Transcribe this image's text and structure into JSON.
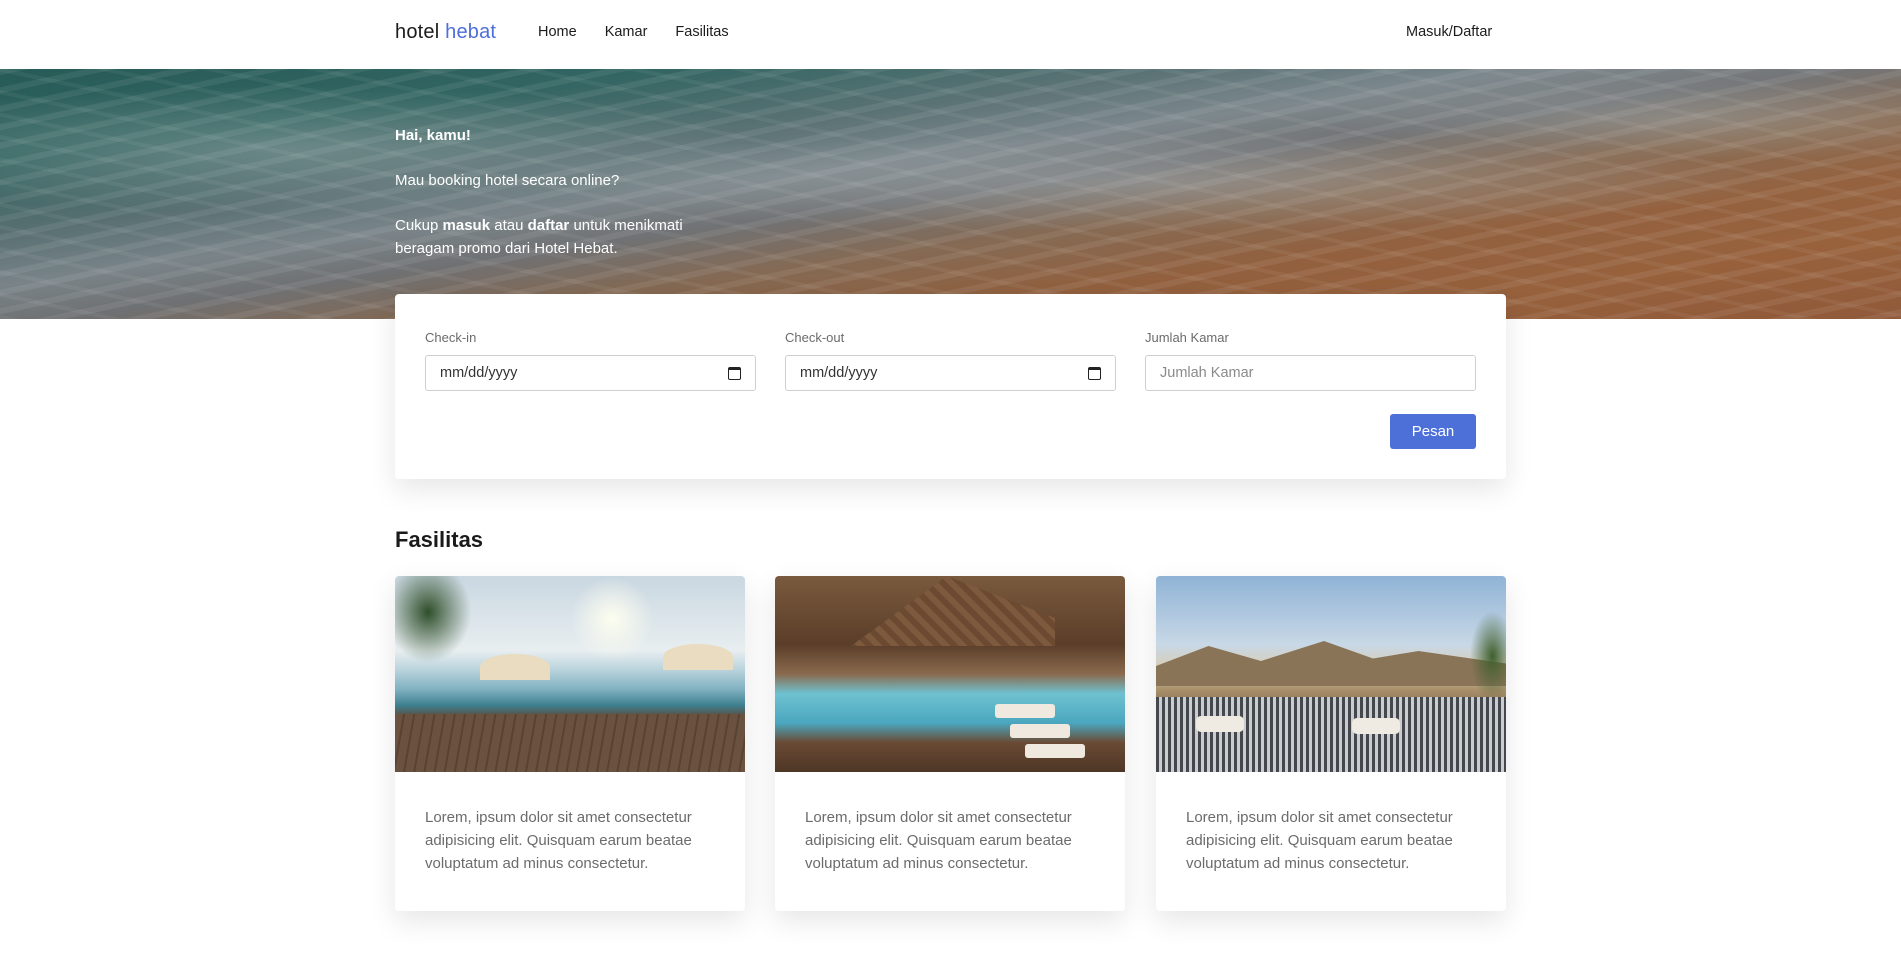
{
  "navbar": {
    "brand_part1": "hotel",
    "brand_part2": "hebat",
    "links": [
      "Home",
      "Kamar",
      "Fasilitas"
    ],
    "login": "Masuk/Daftar"
  },
  "hero": {
    "greeting": "Hai, kamu!",
    "question": "Mau booking hotel secara online?",
    "cta_prefix": "Cukup ",
    "cta_masuk": "masuk",
    "cta_atau": " atau ",
    "cta_daftar": "daftar",
    "cta_suffix": " untuk menikmati beragam promo dari Hotel Hebat."
  },
  "booking": {
    "checkin_label": "Check-in",
    "checkin_value": "mm/dd/yyyy",
    "checkout_label": "Check-out",
    "checkout_value": "mm/dd/yyyy",
    "rooms_label": "Jumlah Kamar",
    "rooms_placeholder": "Jumlah Kamar",
    "submit_label": "Pesan"
  },
  "facilities": {
    "title": "Fasilitas",
    "cards": [
      {
        "text": "Lorem, ipsum dolor sit amet consectetur adipisicing elit. Quisquam earum beatae voluptatum ad minus consectetur."
      },
      {
        "text": "Lorem, ipsum dolor sit amet consectetur adipisicing elit. Quisquam earum beatae voluptatum ad minus consectetur."
      },
      {
        "text": "Lorem, ipsum dolor sit amet consectetur adipisicing elit. Quisquam earum beatae voluptatum ad minus consectetur."
      }
    ]
  },
  "colors": {
    "accent": "#4c6fd8",
    "text_dark": "#1b1b1b",
    "text_muted": "#6b6b6b"
  }
}
